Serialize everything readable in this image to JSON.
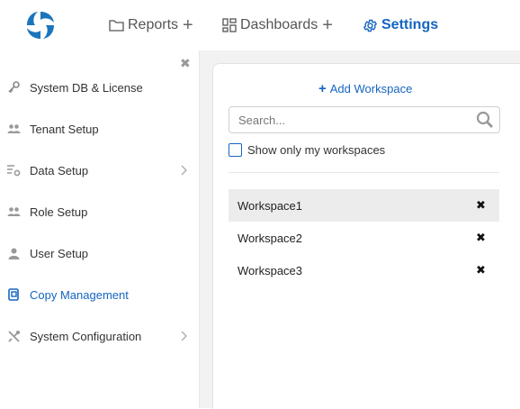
{
  "nav": {
    "logo_icon": "app-logo-swirl",
    "items": [
      {
        "label": "Reports",
        "icon": "folder-icon",
        "plus": "+"
      },
      {
        "label": "Dashboards",
        "icon": "dashboard-grid-icon",
        "plus": "+"
      },
      {
        "label": "Settings",
        "icon": "gear-icon"
      }
    ],
    "accent_color": "#1565c0"
  },
  "sidebar": {
    "close_glyph": "✖",
    "items": [
      {
        "label": "System DB & License",
        "icon": "key-icon",
        "has_submenu": false
      },
      {
        "label": "Tenant Setup",
        "icon": "users-icon",
        "has_submenu": false
      },
      {
        "label": "Data Setup",
        "icon": "data-settings-icon",
        "has_submenu": true
      },
      {
        "label": "Role Setup",
        "icon": "users-icon",
        "has_submenu": false
      },
      {
        "label": "User Setup",
        "icon": "user-icon",
        "has_submenu": false
      },
      {
        "label": "Copy Management",
        "icon": "copy-icon",
        "has_submenu": false,
        "active": true
      },
      {
        "label": "System Configuration",
        "icon": "tools-icon",
        "has_submenu": true
      }
    ]
  },
  "workspace_panel": {
    "add_label": "Add Workspace",
    "add_glyph": "+",
    "search_placeholder": "Search...",
    "search_value": "",
    "filter_label": "Show only my workspaces",
    "filter_checked": false,
    "delete_glyph": "✖",
    "workspaces": [
      {
        "name": "Workspace1",
        "selected": true
      },
      {
        "name": "Workspace2",
        "selected": false
      },
      {
        "name": "Workspace3",
        "selected": false
      }
    ]
  }
}
